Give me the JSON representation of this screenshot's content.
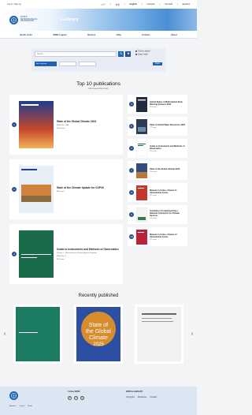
{
  "topbar": {
    "auth_link": "Log in / Sign up",
    "languages": [
      "عربي",
      "中文",
      "English",
      "Français",
      "Русский",
      "Español"
    ],
    "active_lang_index": 2
  },
  "hero": {
    "org_name": "WORLD METEOROLOGICAL ORGANIZATION",
    "library_title": "e-Library"
  },
  "nav": {
    "items": [
      "Quick Links",
      "WMO Legacy",
      "Browse",
      "Help",
      "Contact",
      "About"
    ]
  },
  "search": {
    "placeholder": "Search",
    "full_text": "Full text search",
    "exact_match": "Exact match",
    "type_select": "Any language",
    "reset_label": "Reset"
  },
  "top10": {
    "title": "Top 10 publications",
    "subtitle": "Most viewed this month",
    "big": [
      {
        "num": "1",
        "title": "State of the Global Climate 2024",
        "meta": "WMO-No. 1368",
        "footer": "1152 views"
      },
      {
        "num": "2",
        "title": "State of the Climate Update for COP30",
        "meta": "",
        "footer": "988 views"
      },
      {
        "num": "3",
        "title": "Guide to Instruments and Methods of Observation",
        "meta": "Volume I – Measurement of Meteorological Variables",
        "meta2": "WMO-No. 8",
        "footer": "870 views"
      }
    ],
    "small": [
      {
        "num": "4",
        "title": "Global Status of Multi-Hazard Early Warning Systems 2024",
        "meta": "804 views"
      },
      {
        "num": "5",
        "title": "State of Global Water Resources 2024",
        "meta": "772 views"
      },
      {
        "num": "6",
        "title": "Guide to Instruments and Methods of Observation",
        "meta": "701 views"
      },
      {
        "num": "7",
        "title": "State of the Global Climate 2023",
        "meta": "658 views"
      },
      {
        "num": "8",
        "title": "Manual on Codes, Volume I.1 - International Codes",
        "meta": "612 views"
      },
      {
        "num": "9",
        "title": "Guidelines for Implementing a National Framework for Climate Services",
        "meta": "590 views"
      },
      {
        "num": "10",
        "title": "Manual on Codes, Volume I.2 - International Codes",
        "meta": "574 views"
      }
    ]
  },
  "recent": {
    "title": "Recently published",
    "cards": [
      "Green technical report",
      "State of the Global Climate 2025",
      "Document cover"
    ]
  },
  "footer": {
    "follow": "Follow WMO",
    "elib": "WMO E-LIBRARY",
    "links": [
      "Copyright",
      "Disclaimer",
      "Contact"
    ],
    "bottom_links": [
      "Members",
      "Careers",
      "Media"
    ]
  }
}
